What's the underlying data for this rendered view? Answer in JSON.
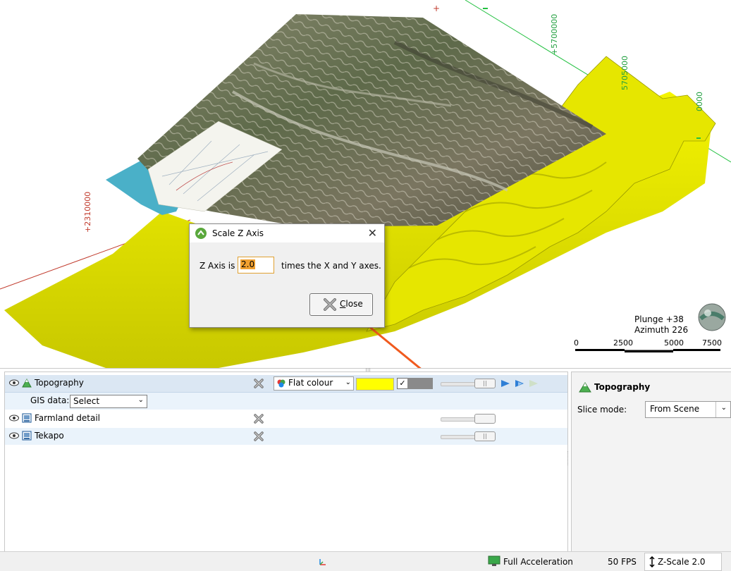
{
  "scene": {
    "axis_labels": {
      "y_left": "+2310000",
      "x1": "+5700000",
      "x2": "5705000",
      "x3": "0000"
    },
    "orientation": {
      "plunge": "Plunge +38",
      "azimuth": "Azimuth 226"
    },
    "scalebar": {
      "ticks": [
        "0",
        "2500",
        "5000",
        "7500"
      ]
    }
  },
  "dialog": {
    "title": "Scale Z Axis",
    "label_before": "Z Axis is",
    "value": "2.0",
    "label_after": "times the X and Y axes.",
    "close_label": "lose",
    "close_mnemonic": "C"
  },
  "object_list": {
    "header": {
      "label": "Topography",
      "display_mode": "Flat colour",
      "colour": "#ffff00",
      "check": "✓"
    },
    "gis": {
      "label": "GIS data:",
      "value": "Select"
    },
    "rows": [
      {
        "label": "Farmland detail"
      },
      {
        "label": "Tekapo"
      }
    ]
  },
  "properties": {
    "title": "Topography",
    "slice_label": "Slice mode:",
    "slice_value": "From Scene"
  },
  "status": {
    "acceleration": "Full Acceleration",
    "fps": "50 FPS",
    "zscale": "Z-Scale 2.0"
  },
  "colors": {
    "surface": "#ffff00",
    "accent_arrow": "#f05a1e",
    "axis_red": "#c0392b",
    "axis_green": "#22c040",
    "header_row": "#dbe7f3"
  }
}
